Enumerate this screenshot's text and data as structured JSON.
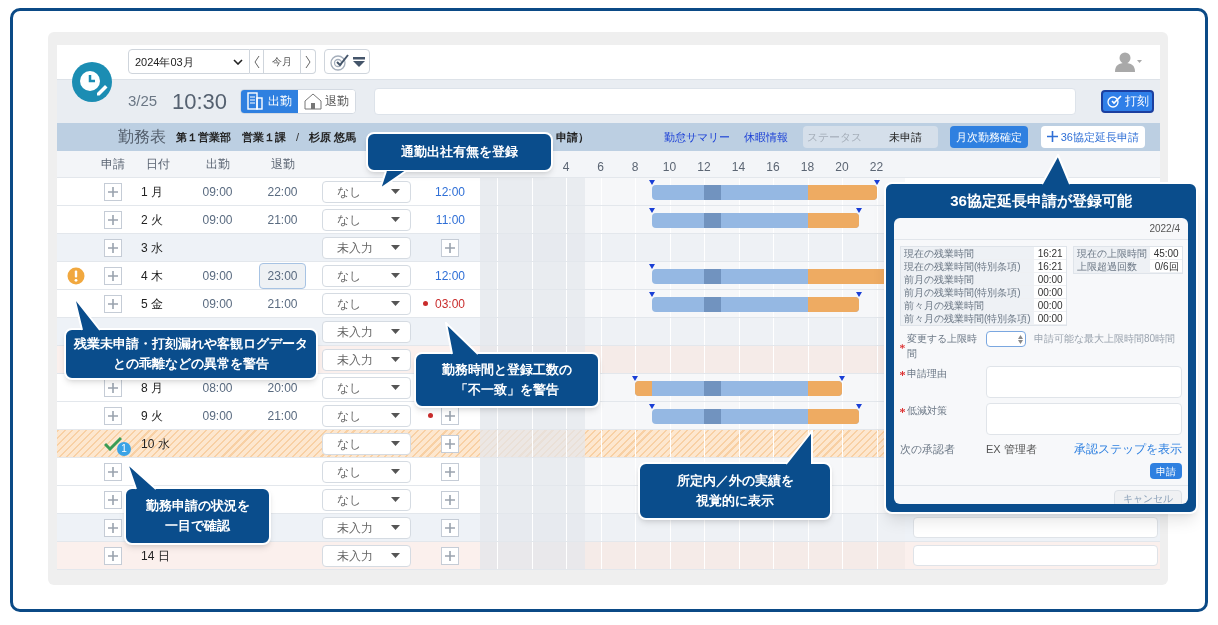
{
  "app": {
    "month_select": "2024年03月",
    "today_button": "今月",
    "date": "3/25",
    "time": "10:30",
    "punch_tabs": [
      {
        "label": "出勤",
        "kind": "in",
        "selected": true
      },
      {
        "label": "退勤",
        "kind": "out",
        "selected": false
      }
    ],
    "punch_button": "打刻",
    "sheet_header": {
      "title": "勤務表",
      "department": "第１営業部　営業１課",
      "separator": "/",
      "employee": "杉原 悠馬",
      "partial": "申請）"
    },
    "links": [
      "勤怠サマリー",
      "休暇情報"
    ],
    "status": {
      "label": "ステータス",
      "value": "未申請"
    },
    "confirm_button": "月次勤務確定",
    "extension_button": "36協定延長申請"
  },
  "columns": [
    "申請",
    "日付",
    "出勤",
    "退勤"
  ],
  "hour_ticks": [
    "4",
    "6",
    "8",
    "10",
    "12",
    "14",
    "16",
    "18",
    "20",
    "22"
  ],
  "rows": [
    {
      "kind": "workday",
      "warning": false,
      "apply": {
        "kind": "add"
      },
      "date": "1 月",
      "clock_in": "09:00",
      "clock_out": "22:00",
      "focused": false,
      "commute": "なし",
      "effort": {
        "kind": "time",
        "value": "12:00",
        "mismatch": false
      }
    },
    {
      "kind": "workday",
      "warning": false,
      "apply": {
        "kind": "add"
      },
      "date": "2 火",
      "clock_in": "09:00",
      "clock_out": "21:00",
      "focused": false,
      "commute": "なし",
      "effort": {
        "kind": "time",
        "value": "11:00",
        "mismatch": false
      }
    },
    {
      "kind": "holiday",
      "warning": false,
      "apply": {
        "kind": "add"
      },
      "date": "3 水",
      "commute": "未入力",
      "effort": {
        "kind": "add",
        "mismatch": false
      }
    },
    {
      "kind": "workday",
      "warning": true,
      "apply": {
        "kind": "add"
      },
      "date": "4 木",
      "clock_in": "09:00",
      "clock_out": "23:00",
      "focused": true,
      "commute": "なし",
      "effort": {
        "kind": "time",
        "value": "12:00",
        "mismatch": false
      }
    },
    {
      "kind": "workday",
      "warning": false,
      "apply": {
        "kind": "add"
      },
      "date": "5 金",
      "clock_in": "09:00",
      "clock_out": "21:00",
      "focused": false,
      "commute": "なし",
      "effort": {
        "kind": "time",
        "value": "03:00",
        "mismatch": true
      }
    },
    {
      "kind": "holiday",
      "warning": false,
      "commute": "未入力"
    },
    {
      "kind": "legal_holiday",
      "warning": false,
      "commute": "未入力"
    },
    {
      "kind": "workday",
      "warning": false,
      "apply": {
        "kind": "add"
      },
      "date": "8 月",
      "clock_in": "08:00",
      "clock_out": "20:00",
      "focused": false,
      "commute": "なし"
    },
    {
      "kind": "workday",
      "warning": false,
      "apply": {
        "kind": "add"
      },
      "date": "9 火",
      "clock_in": "09:00",
      "clock_out": "21:00",
      "focused": false,
      "commute": "なし",
      "effort": {
        "kind": "add",
        "mismatch": true
      }
    },
    {
      "kind": "requested",
      "warning": false,
      "apply": {
        "kind": "approved",
        "badge": "1"
      },
      "date": "10 水",
      "commute": "なし",
      "effort": {
        "kind": "add",
        "mismatch": false
      }
    },
    {
      "kind": "workday",
      "warning": false,
      "apply": {
        "kind": "add"
      },
      "commute": "なし",
      "effort": {
        "kind": "add",
        "mismatch": false
      }
    },
    {
      "kind": "workday",
      "warning": false,
      "apply": {
        "kind": "add"
      },
      "commute": "なし",
      "effort": {
        "kind": "add",
        "mismatch": false
      }
    },
    {
      "kind": "holiday",
      "warning": false,
      "apply": {
        "kind": "add"
      },
      "commute": "未入力",
      "effort": {
        "kind": "add",
        "mismatch": false
      },
      "remark_field": true
    },
    {
      "kind": "legal_holiday",
      "warning": false,
      "apply": {
        "kind": "add"
      },
      "date": "14 日",
      "commute": "未入力",
      "effort": {
        "kind": "add",
        "mismatch": false
      },
      "remark_field": true
    }
  ],
  "callouts": [
    {
      "lines": [
        "通勤出社有無を登録"
      ]
    },
    {
      "lines": [
        "残業未申請・打刻漏れや客観ログデータ",
        "との乖離などの異常を警告"
      ]
    },
    {
      "lines": [
        "勤務時間と登録工数の",
        "「不一致」を警告"
      ]
    },
    {
      "lines": [
        "勤務申請の状況を",
        "一目で確認"
      ]
    },
    {
      "lines": [
        "所定内／外の実績を",
        "視覚的に表示"
      ]
    }
  ],
  "extension_panel": {
    "title": "36協定延長申請が登録可能",
    "period": "2022/4",
    "overtime_table": [
      {
        "label": "現在の残業時間",
        "value": "16:21"
      },
      {
        "label": "現在の残業時間(特別条項)",
        "value": "16:21"
      },
      {
        "label": "前月の残業時間",
        "value": "00:00"
      },
      {
        "label": "前月の残業時間(特別条項)",
        "value": "00:00"
      },
      {
        "label": "前々月の残業時間",
        "value": "00:00"
      },
      {
        "label": "前々月の残業時間(特別条項)",
        "value": "00:00"
      }
    ],
    "limit_table": [
      {
        "label": "現在の上限時間",
        "value": "45:00"
      },
      {
        "label": "上限超過回数",
        "value": "0/6回"
      }
    ],
    "fields": [
      {
        "label": "変更する上限時間",
        "kind": "number",
        "hint": "申請可能な最大上限時間80時間",
        "required": true
      },
      {
        "label": "申請理由",
        "kind": "textarea",
        "required": true
      },
      {
        "label": "低減対策",
        "kind": "textarea",
        "required": true
      }
    ],
    "approver": {
      "label": "次の承認者",
      "value": "EX 管理者",
      "link": "承認ステップを表示"
    },
    "submit": "申請",
    "cancel": "キャンセル"
  }
}
